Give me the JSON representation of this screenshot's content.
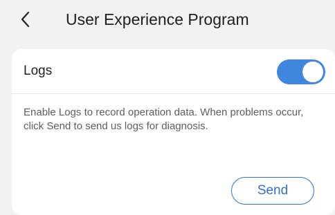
{
  "header": {
    "back_icon": "chevron-left-icon",
    "title": "User Experience Program"
  },
  "logs": {
    "label": "Logs",
    "toggle_on": true,
    "toggle_color": "#3f86df",
    "description": "Enable Logs to record operation data. When problems occur, click Send to send us logs for diagnosis.",
    "send_label": "Send",
    "send_color": "#2f6fc7"
  }
}
